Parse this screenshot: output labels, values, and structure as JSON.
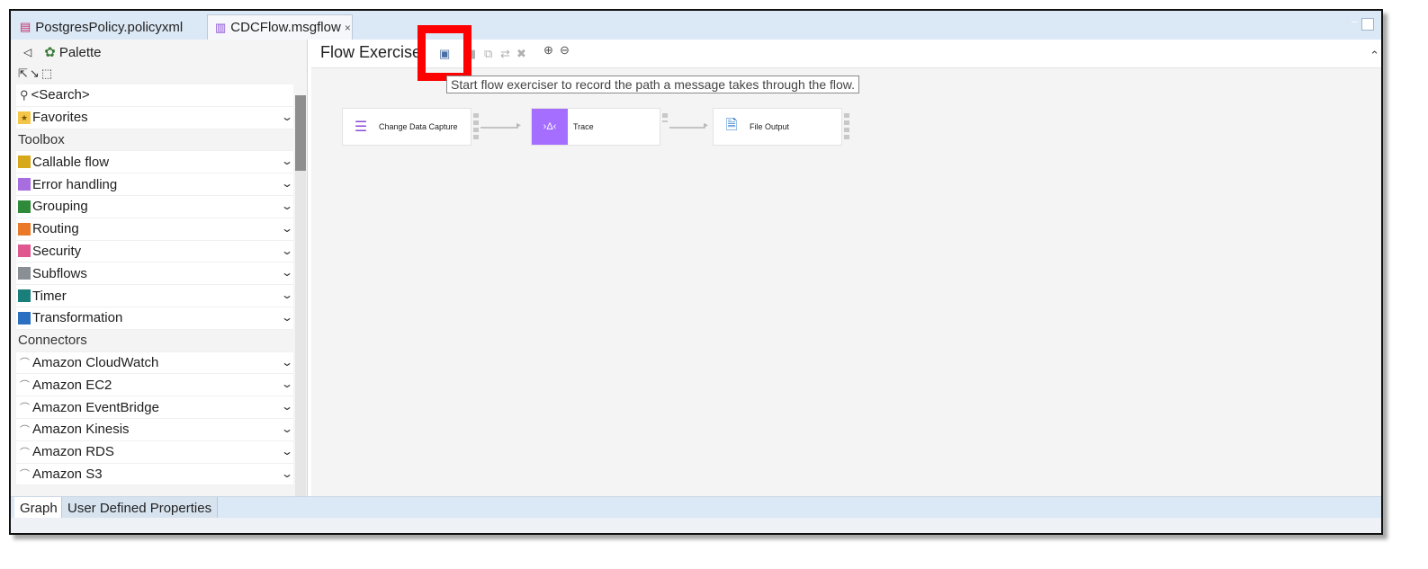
{
  "tabs": [
    {
      "label": "PostgresPolicy.policyxml",
      "icon": "policy-icon"
    },
    {
      "label": "CDCFlow.msgflow",
      "icon": "msgflow-icon",
      "close": "×"
    }
  ],
  "palette": {
    "title": "Palette",
    "search": "<Search>",
    "favorites": "Favorites",
    "toolbox_header": "Toolbox",
    "toolbox": [
      {
        "label": "Callable flow",
        "color": "#d6a81a"
      },
      {
        "label": "Error handling",
        "color": "#a86ee0"
      },
      {
        "label": "Grouping",
        "color": "#2f8a3a"
      },
      {
        "label": "Routing",
        "color": "#ea7a2a"
      },
      {
        "label": "Security",
        "color": "#e0578f"
      },
      {
        "label": "Subflows",
        "color": "#8a8f96"
      },
      {
        "label": "Timer",
        "color": "#1a7f7a"
      },
      {
        "label": "Transformation",
        "color": "#2b6fc0"
      }
    ],
    "connectors_header": "Connectors",
    "connectors": [
      {
        "label": "Amazon CloudWatch"
      },
      {
        "label": "Amazon EC2"
      },
      {
        "label": "Amazon EventBridge"
      },
      {
        "label": "Amazon Kinesis"
      },
      {
        "label": "Amazon RDS"
      },
      {
        "label": "Amazon S3"
      }
    ]
  },
  "editor": {
    "title": "Flow Exercise",
    "tooltip": "Start flow exerciser to record the path a message takes through the flow."
  },
  "nodes": [
    {
      "label": "Change Data Capture",
      "icon": "database-icon"
    },
    {
      "label": "Trace",
      "icon": "trace-icon",
      "icon_text": "›Δ‹"
    },
    {
      "label": "File Output",
      "icon": "file-icon"
    }
  ],
  "bottom_tabs": [
    "Graph",
    "User Defined Properties"
  ]
}
